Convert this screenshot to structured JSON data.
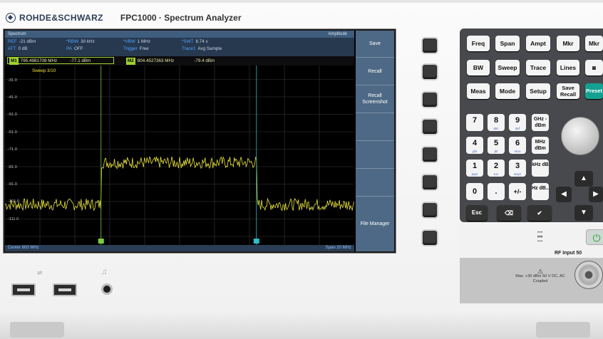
{
  "brand": {
    "name": "ROHDE&SCHWARZ",
    "model": "FPC1000 · Spectrum Analyzer"
  },
  "screen": {
    "title": "Spectrum",
    "mode": "Amplitude",
    "params": {
      "ref_key": "REF",
      "ref_val": "-21 dBm",
      "att_key": "ATT",
      "att_val": "0 dB",
      "rbw_key": "*RBW",
      "rbw_val": "30 kHz",
      "pa_key": "PA",
      "pa_val": "OFF",
      "vbw_key": "*VBW",
      "vbw_val": "1 MHz",
      "trigger_key": "Trigger",
      "trigger_val": "Free",
      "swt_key": "*SWT",
      "swt_val": "8.74 s",
      "trace_key": "Trace1",
      "trace_val": "Avg Sample"
    },
    "markers": [
      {
        "tag": "M1",
        "freq": "795.4981708 MHz",
        "level": "-77.1 dBm"
      },
      {
        "tag": "M2",
        "freq": "804.4527363 MHz",
        "level": "-79.4 dBm"
      }
    ],
    "sweep": "Sweep 3/10",
    "y_ticks": [
      "-31.0",
      "-41.0",
      "-51.0",
      "-61.0",
      "-71.0",
      "-81.0",
      "-91.0",
      "-101.0",
      "-111.0"
    ],
    "footer": {
      "center": "Center 800 MHz",
      "span": "Span 20 MHz"
    },
    "marker_flags": [
      "M1",
      "D2"
    ]
  },
  "softkeys": [
    "Save",
    "Recall",
    "Recall Screenshot",
    "",
    "",
    "",
    "File Manager"
  ],
  "keypad": {
    "function_keys": [
      "Freq",
      "Span",
      "Ampt",
      "Mkr",
      "Mkr",
      "BW",
      "Sweep",
      "Trace",
      "Lines",
      "",
      "Meas",
      "Mode",
      "Setup",
      "Save Recall",
      "Preset"
    ],
    "numeric": [
      {
        "d": "7",
        "s": ""
      },
      {
        "d": "8",
        "s": "abc"
      },
      {
        "d": "9",
        "s": "def"
      },
      {
        "d": "4",
        "s": "ghi"
      },
      {
        "d": "5",
        "s": "jkl"
      },
      {
        "d": "6",
        "s": "mno"
      },
      {
        "d": "1",
        "s": "pqrs"
      },
      {
        "d": "2",
        "s": "tuv"
      },
      {
        "d": "3",
        "s": "wxyz"
      },
      {
        "d": "0",
        "s": ""
      },
      {
        "d": ".",
        "s": ""
      },
      {
        "d": "+/-",
        "s": ""
      }
    ],
    "units": [
      "GHz -dBm",
      "MHz dBm",
      "kHz dB",
      "Hz dB.."
    ],
    "esc": "Esc"
  },
  "rf": {
    "label": "RF Input 50",
    "warning": "Max. +30 dBm 50 V DC, AC Coupled"
  },
  "chart_data": {
    "type": "line",
    "x_range": [
      "790 MHz",
      "810 MHz"
    ],
    "ylim": [
      -111,
      -21
    ],
    "series": [
      {
        "values_description_points": [
          [
            790,
            -92
          ],
          [
            791,
            -91
          ],
          [
            792,
            -92
          ],
          [
            793,
            -90
          ],
          [
            794,
            -91
          ],
          [
            795.5,
            -91
          ],
          [
            795.5,
            -70
          ],
          [
            797,
            -71
          ],
          [
            799,
            -70
          ],
          [
            801,
            -71
          ],
          [
            803,
            -70
          ],
          [
            804.4,
            -71
          ],
          [
            804.4,
            -92
          ],
          [
            806,
            -91
          ],
          [
            808,
            -92
          ],
          [
            810,
            -91
          ]
        ]
      }
    ]
  }
}
